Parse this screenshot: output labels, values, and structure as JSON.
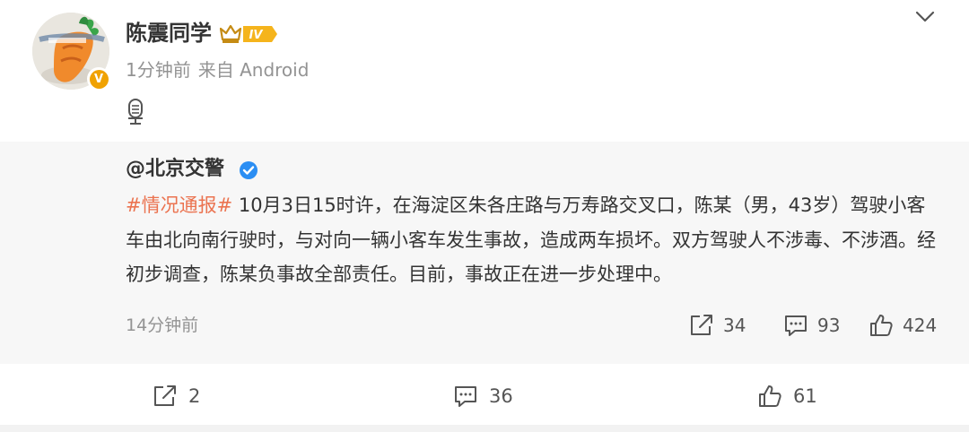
{
  "post": {
    "username": "陈震同学",
    "level_label": "IV",
    "time": "1分钟前",
    "source": "来自 Android"
  },
  "repost": {
    "username": "@北京交警",
    "topic": "#情况通报#",
    "text": " 10月3日15时许，在海淀区朱各庄路与万寿路交叉口，陈某（男，43岁）驾驶小客车由北向南行驶时，与对向一辆小客车发生事故，造成两车损坏。双方驾驶人不涉毒、不涉酒。经初步调查，陈某负事故全部责任。目前，事故正在进一步处理中。",
    "time": "14分钟前",
    "shares": "34",
    "comments": "93",
    "likes": "424"
  },
  "footer": {
    "shares": "2",
    "comments": "36",
    "likes": "61"
  }
}
